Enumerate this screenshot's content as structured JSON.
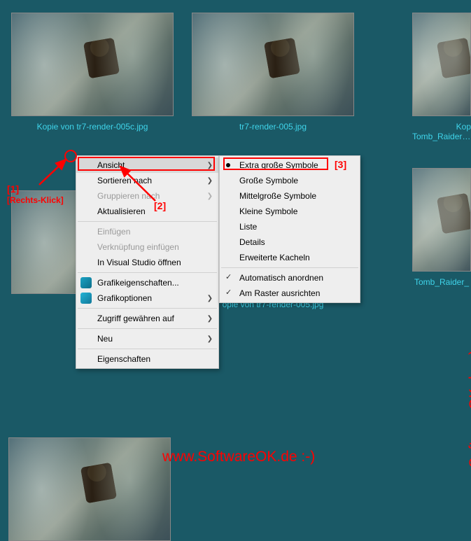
{
  "files": {
    "r1c1": "Kopie von tr7-render-005c.jpg",
    "r1c2": "tr7-render-005.jpg",
    "r1c3a": "Kop",
    "r1c3b": "Tomb_Raider_Lege",
    "r2c2": "opie von tr7-render-005.jpg",
    "r2c3": "Tomb_Raider_"
  },
  "menu1": {
    "ansicht": "Ansicht",
    "sortieren": "Sortieren nach",
    "gruppieren": "Gruppieren nach",
    "aktualisieren": "Aktualisieren",
    "einfuegen": "Einfügen",
    "verknuepfung": "Verknüpfung einfügen",
    "vsoeffnen": "In Visual Studio öffnen",
    "grafikeig": "Grafikeigenschaften...",
    "grafikopt": "Grafikoptionen",
    "zugriff": "Zugriff gewähren auf",
    "neu": "Neu",
    "eigenschaften": "Eigenschaften"
  },
  "menu2": {
    "extra": "Extra große Symbole",
    "gross": "Große Symbole",
    "mittel": "Mittelgroße Symbole",
    "klein": "Kleine Symbole",
    "liste": "Liste",
    "details": "Details",
    "kacheln": "Erweiterte Kacheln",
    "auto": "Automatisch anordnen",
    "raster": "Am Raster ausrichten"
  },
  "anno": {
    "n1": "[1]",
    "n1b": "[Rechts-Klick]",
    "n2": "[2]",
    "n3": "[3]"
  },
  "watermark": "www.SoftwareOK.de :-)"
}
